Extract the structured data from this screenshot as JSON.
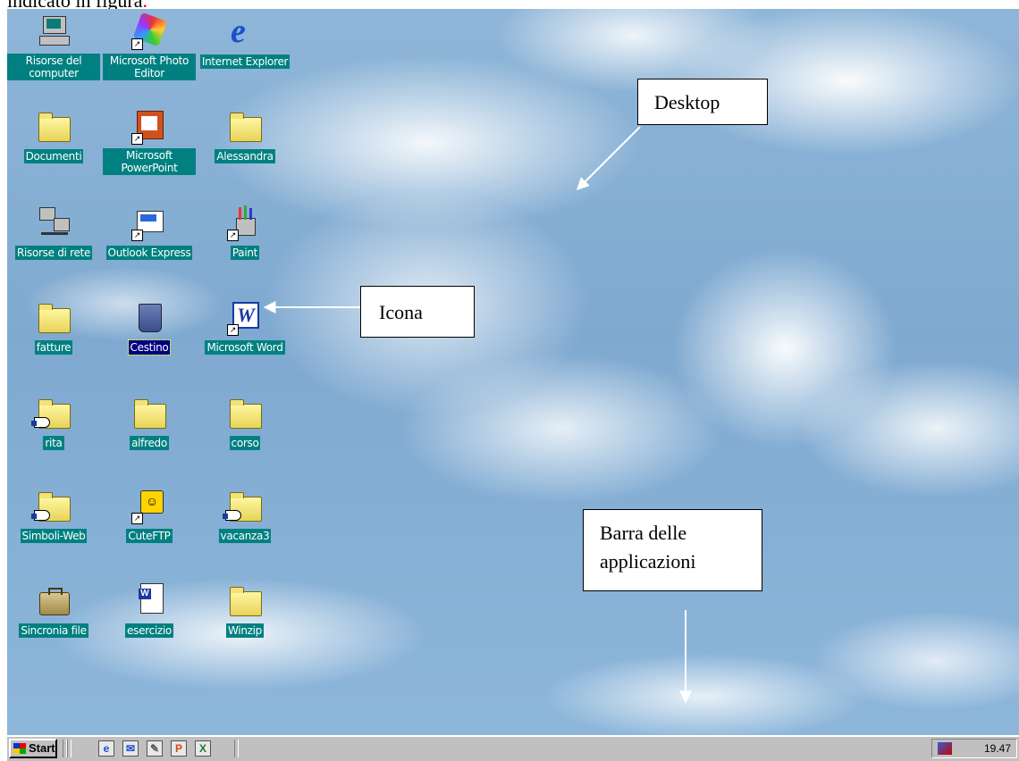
{
  "caption": {
    "text": "indicato in figura",
    "punct": "."
  },
  "desktop": {
    "icons": [
      {
        "label": "Risorse del computer",
        "icon": "my-computer-icon"
      },
      {
        "label": "Microsoft Photo Editor",
        "icon": "photo-editor-icon"
      },
      {
        "label": "Internet Explorer",
        "icon": "internet-explorer-icon"
      },
      {
        "label": "Documenti",
        "icon": "documents-folder-icon"
      },
      {
        "label": "Microsoft PowerPoint",
        "icon": "powerpoint-icon"
      },
      {
        "label": "Alessandra",
        "icon": "folder-icon"
      },
      {
        "label": "Risorse di rete",
        "icon": "network-icon"
      },
      {
        "label": "Outlook Express",
        "icon": "outlook-express-icon"
      },
      {
        "label": "Paint",
        "icon": "paint-icon"
      },
      {
        "label": "fatture",
        "icon": "folder-icon"
      },
      {
        "label": "Cestino",
        "icon": "recycle-bin-icon"
      },
      {
        "label": "Microsoft Word",
        "icon": "word-icon"
      },
      {
        "label": "rita",
        "icon": "shared-folder-icon"
      },
      {
        "label": "alfredo",
        "icon": "folder-icon"
      },
      {
        "label": "corso",
        "icon": "folder-icon"
      },
      {
        "label": "Simboli-Web",
        "icon": "shared-folder-icon"
      },
      {
        "label": "CuteFTP",
        "icon": "cuteftp-icon"
      },
      {
        "label": "vacanza3",
        "icon": "shared-folder-icon"
      },
      {
        "label": "Sincronia file",
        "icon": "briefcase-icon"
      },
      {
        "label": "esercizio",
        "icon": "word-document-icon"
      },
      {
        "label": "Winzip",
        "icon": "folder-icon"
      }
    ],
    "selected": "Cestino"
  },
  "callouts": {
    "desktop": "Desktop",
    "icon": "Icona",
    "taskbar_line1": "Barra delle",
    "taskbar_line2": "applicazioni"
  },
  "taskbar": {
    "start_label": "Start",
    "quick_launch": [
      {
        "icon": "ie-quicklaunch-icon",
        "glyph": "e",
        "color": "#1a4fcf"
      },
      {
        "icon": "outlook-quicklaunch-icon",
        "glyph": "✉",
        "color": "#1a4fcf"
      },
      {
        "icon": "paint-quicklaunch-icon",
        "glyph": "✎",
        "color": "#555555"
      },
      {
        "icon": "powerpoint-quicklaunch-icon",
        "glyph": "P",
        "color": "#d24a1a"
      },
      {
        "icon": "excel-quicklaunch-icon",
        "glyph": "X",
        "color": "#1a7a2a"
      }
    ],
    "clock": "19.47"
  }
}
